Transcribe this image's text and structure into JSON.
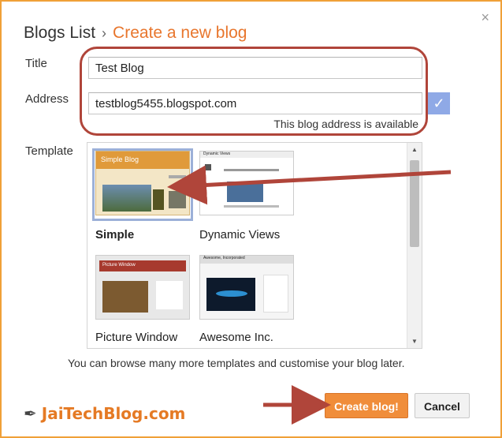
{
  "breadcrumb": {
    "root": "Blogs List",
    "separator": "›",
    "current": "Create a new blog"
  },
  "close_icon": "×",
  "fields": {
    "title": {
      "label": "Title",
      "value": "Test Blog"
    },
    "address": {
      "label": "Address",
      "value": "testblog5455.blogspot.com",
      "status": "This blog address is available"
    }
  },
  "check_icon": "✓",
  "template_label": "Template",
  "templates": [
    {
      "name": "Simple",
      "selected": true
    },
    {
      "name": "Dynamic Views",
      "selected": false
    },
    {
      "name": "Picture Window",
      "selected": false
    },
    {
      "name": "Awesome Inc.",
      "selected": false
    }
  ],
  "template_previews": {
    "simple": "Simple Blog",
    "dynamic": "Dynamic Views",
    "picture": "Picture Window",
    "awesome": "Awesome, Incorporated"
  },
  "browse_text": "You can browse many more templates and customise your blog later.",
  "buttons": {
    "create": "Create blog!",
    "cancel": "Cancel"
  },
  "logo": {
    "text": "JaiTechBlog.com",
    "icon": "feather-icon"
  },
  "colors": {
    "accent": "#e8762d",
    "annotation": "#b0453a",
    "primary_button": "#f08d3a"
  }
}
